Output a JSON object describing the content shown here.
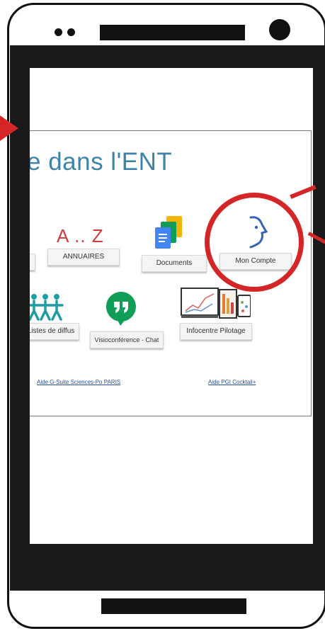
{
  "page": {
    "title": "e dans l'ENT"
  },
  "tiles": {
    "annuaires": {
      "glyph": "A .. Z",
      "label": "ANNUAIRES"
    },
    "documents": {
      "label": "Documents"
    },
    "mon_compte": {
      "label": "Mon Compte"
    },
    "listes": {
      "label": "Listes de diffus"
    },
    "visio": {
      "label": "Visioconférence - Chat"
    },
    "infocentre": {
      "label": "Infocentre Pilotage"
    }
  },
  "links": {
    "gsuite": "Aide G-Suite Sciences-Po PARIS",
    "pgi": "Aide PGI Cocktail+"
  },
  "colors": {
    "title_blue": "#3d83a6",
    "highlight_red": "#d42626",
    "az_red": "#d63b3b",
    "hangouts_green": "#0f9d58",
    "teal_people": "#1e9ca6"
  }
}
